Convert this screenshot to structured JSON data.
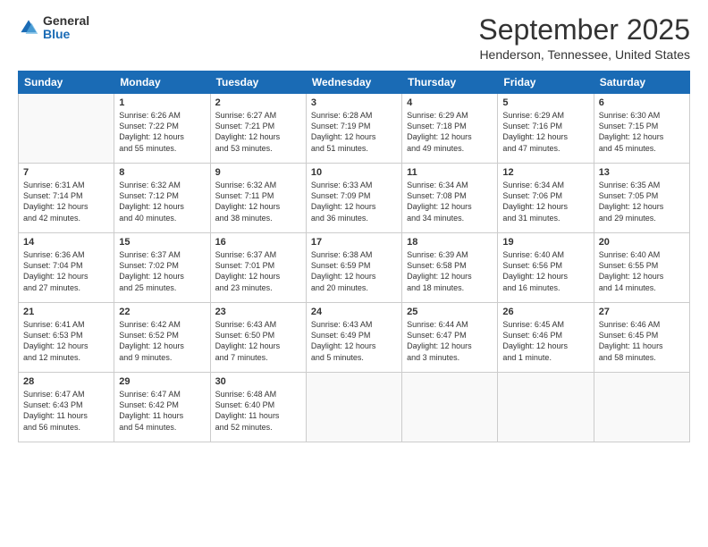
{
  "header": {
    "logo": {
      "general": "General",
      "blue": "Blue"
    },
    "title": "September 2025",
    "location": "Henderson, Tennessee, United States"
  },
  "days_of_week": [
    "Sunday",
    "Monday",
    "Tuesday",
    "Wednesday",
    "Thursday",
    "Friday",
    "Saturday"
  ],
  "weeks": [
    [
      {
        "day": "",
        "info": ""
      },
      {
        "day": "1",
        "info": "Sunrise: 6:26 AM\nSunset: 7:22 PM\nDaylight: 12 hours\nand 55 minutes."
      },
      {
        "day": "2",
        "info": "Sunrise: 6:27 AM\nSunset: 7:21 PM\nDaylight: 12 hours\nand 53 minutes."
      },
      {
        "day": "3",
        "info": "Sunrise: 6:28 AM\nSunset: 7:19 PM\nDaylight: 12 hours\nand 51 minutes."
      },
      {
        "day": "4",
        "info": "Sunrise: 6:29 AM\nSunset: 7:18 PM\nDaylight: 12 hours\nand 49 minutes."
      },
      {
        "day": "5",
        "info": "Sunrise: 6:29 AM\nSunset: 7:16 PM\nDaylight: 12 hours\nand 47 minutes."
      },
      {
        "day": "6",
        "info": "Sunrise: 6:30 AM\nSunset: 7:15 PM\nDaylight: 12 hours\nand 45 minutes."
      }
    ],
    [
      {
        "day": "7",
        "info": "Sunrise: 6:31 AM\nSunset: 7:14 PM\nDaylight: 12 hours\nand 42 minutes."
      },
      {
        "day": "8",
        "info": "Sunrise: 6:32 AM\nSunset: 7:12 PM\nDaylight: 12 hours\nand 40 minutes."
      },
      {
        "day": "9",
        "info": "Sunrise: 6:32 AM\nSunset: 7:11 PM\nDaylight: 12 hours\nand 38 minutes."
      },
      {
        "day": "10",
        "info": "Sunrise: 6:33 AM\nSunset: 7:09 PM\nDaylight: 12 hours\nand 36 minutes."
      },
      {
        "day": "11",
        "info": "Sunrise: 6:34 AM\nSunset: 7:08 PM\nDaylight: 12 hours\nand 34 minutes."
      },
      {
        "day": "12",
        "info": "Sunrise: 6:34 AM\nSunset: 7:06 PM\nDaylight: 12 hours\nand 31 minutes."
      },
      {
        "day": "13",
        "info": "Sunrise: 6:35 AM\nSunset: 7:05 PM\nDaylight: 12 hours\nand 29 minutes."
      }
    ],
    [
      {
        "day": "14",
        "info": "Sunrise: 6:36 AM\nSunset: 7:04 PM\nDaylight: 12 hours\nand 27 minutes."
      },
      {
        "day": "15",
        "info": "Sunrise: 6:37 AM\nSunset: 7:02 PM\nDaylight: 12 hours\nand 25 minutes."
      },
      {
        "day": "16",
        "info": "Sunrise: 6:37 AM\nSunset: 7:01 PM\nDaylight: 12 hours\nand 23 minutes."
      },
      {
        "day": "17",
        "info": "Sunrise: 6:38 AM\nSunset: 6:59 PM\nDaylight: 12 hours\nand 20 minutes."
      },
      {
        "day": "18",
        "info": "Sunrise: 6:39 AM\nSunset: 6:58 PM\nDaylight: 12 hours\nand 18 minutes."
      },
      {
        "day": "19",
        "info": "Sunrise: 6:40 AM\nSunset: 6:56 PM\nDaylight: 12 hours\nand 16 minutes."
      },
      {
        "day": "20",
        "info": "Sunrise: 6:40 AM\nSunset: 6:55 PM\nDaylight: 12 hours\nand 14 minutes."
      }
    ],
    [
      {
        "day": "21",
        "info": "Sunrise: 6:41 AM\nSunset: 6:53 PM\nDaylight: 12 hours\nand 12 minutes."
      },
      {
        "day": "22",
        "info": "Sunrise: 6:42 AM\nSunset: 6:52 PM\nDaylight: 12 hours\nand 9 minutes."
      },
      {
        "day": "23",
        "info": "Sunrise: 6:43 AM\nSunset: 6:50 PM\nDaylight: 12 hours\nand 7 minutes."
      },
      {
        "day": "24",
        "info": "Sunrise: 6:43 AM\nSunset: 6:49 PM\nDaylight: 12 hours\nand 5 minutes."
      },
      {
        "day": "25",
        "info": "Sunrise: 6:44 AM\nSunset: 6:47 PM\nDaylight: 12 hours\nand 3 minutes."
      },
      {
        "day": "26",
        "info": "Sunrise: 6:45 AM\nSunset: 6:46 PM\nDaylight: 12 hours\nand 1 minute."
      },
      {
        "day": "27",
        "info": "Sunrise: 6:46 AM\nSunset: 6:45 PM\nDaylight: 11 hours\nand 58 minutes."
      }
    ],
    [
      {
        "day": "28",
        "info": "Sunrise: 6:47 AM\nSunset: 6:43 PM\nDaylight: 11 hours\nand 56 minutes."
      },
      {
        "day": "29",
        "info": "Sunrise: 6:47 AM\nSunset: 6:42 PM\nDaylight: 11 hours\nand 54 minutes."
      },
      {
        "day": "30",
        "info": "Sunrise: 6:48 AM\nSunset: 6:40 PM\nDaylight: 11 hours\nand 52 minutes."
      },
      {
        "day": "",
        "info": ""
      },
      {
        "day": "",
        "info": ""
      },
      {
        "day": "",
        "info": ""
      },
      {
        "day": "",
        "info": ""
      }
    ]
  ]
}
